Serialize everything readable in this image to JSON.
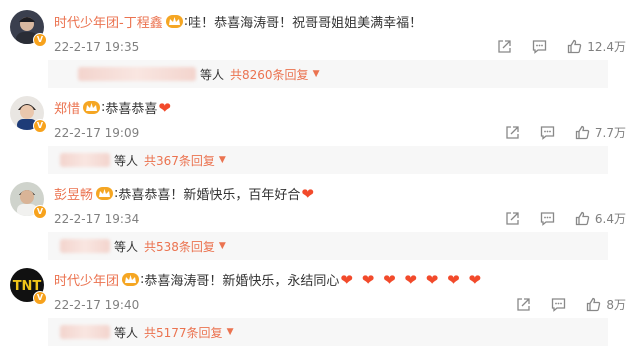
{
  "comments": [
    {
      "user": "时代少年团-丁程鑫",
      "text": "哇！恭喜海涛哥！祝哥哥姐姐美满幸福！",
      "hearts": "",
      "date": "22-2-17 19:35",
      "likes": "12.4万",
      "replies_suffix": "等人",
      "reply_count": "共8260条回复"
    },
    {
      "user": "郑惜",
      "text": "恭喜恭喜",
      "hearts": "❤",
      "date": "22-2-17 19:09",
      "likes": "7.7万",
      "replies_suffix": "等人",
      "reply_count": "共367条回复"
    },
    {
      "user": "彭昱畅",
      "text": "恭喜恭喜！新婚快乐，百年好合",
      "hearts": "❤",
      "date": "22-2-17 19:34",
      "likes": "6.4万",
      "replies_suffix": "等人",
      "reply_count": "共538条回复"
    },
    {
      "user": "时代少年团",
      "text": "恭喜海涛哥！新婚快乐，永结同心",
      "hearts": "❤ ❤ ❤ ❤ ❤ ❤ ❤",
      "date": "22-2-17 19:40",
      "likes": "8万",
      "replies_suffix": "等人",
      "reply_count": "共5177条回复"
    }
  ],
  "colors": {
    "username": "#eb7350",
    "heart": "#f24a2b",
    "meta": "#808080",
    "reply_bg": "#f7f7f7"
  },
  "icons": [
    "share-icon",
    "comment-icon",
    "like-icon",
    "vip-crown-icon",
    "verified-badge-icon"
  ]
}
